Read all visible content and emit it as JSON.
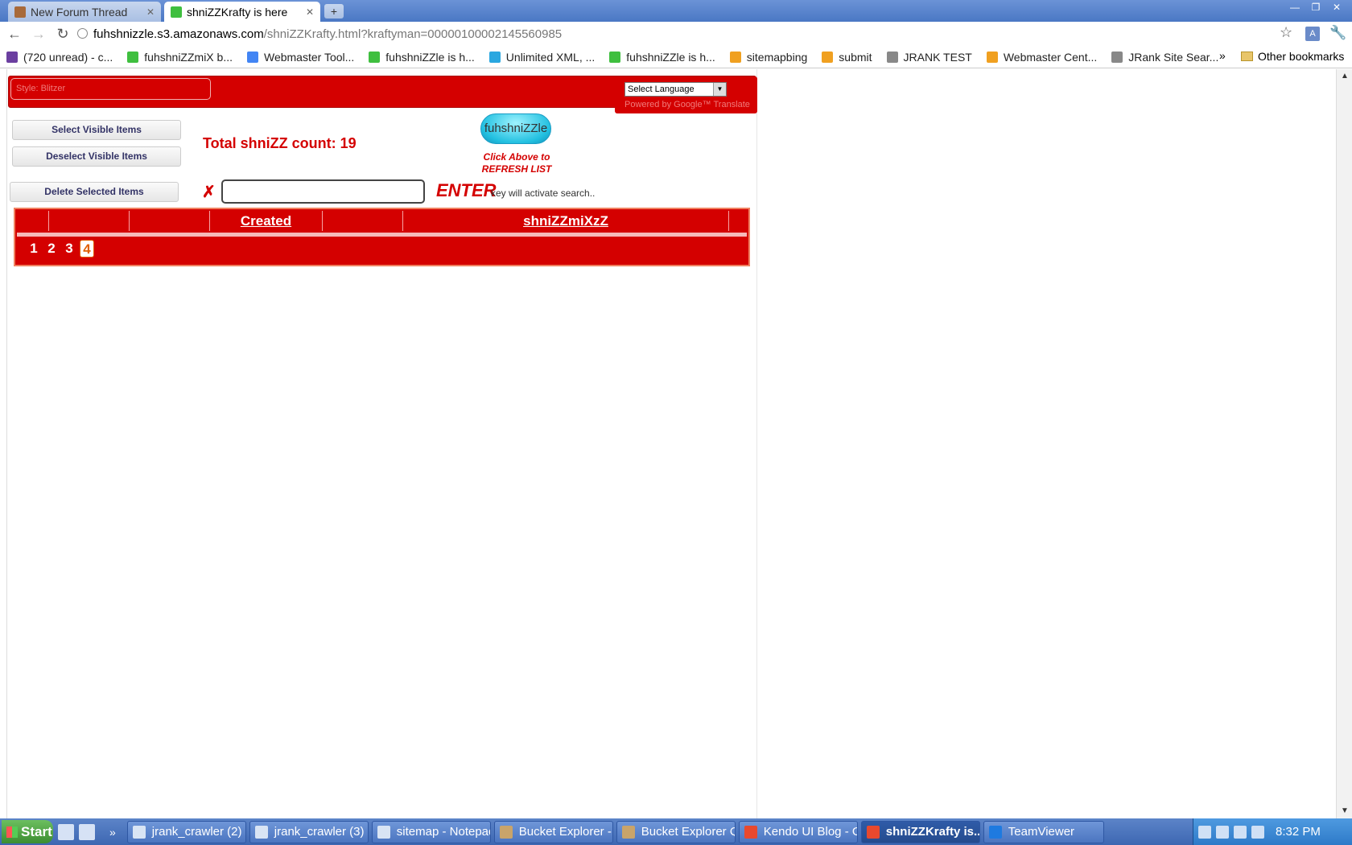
{
  "browser": {
    "tabs": [
      {
        "title": "New Forum Thread",
        "active": false
      },
      {
        "title": "shniZZKrafty is here",
        "active": true
      }
    ],
    "url_host": "fuhshnizzle.s3.amazonaws.com",
    "url_path": "/shniZZKrafty.html?kraftyman=000001000021455609​85",
    "bookmarks": [
      {
        "label": "(720 unread) - c...",
        "color": "#6b3fa0"
      },
      {
        "label": "fuhshniZZmiX b...",
        "color": "#3fbf3f"
      },
      {
        "label": "Webmaster Tool...",
        "color": "#4285f4"
      },
      {
        "label": "fuhshniZZle is h...",
        "color": "#3fbf3f"
      },
      {
        "label": "Unlimited XML, ...",
        "color": "#2aa7e0"
      },
      {
        "label": "fuhshniZZle is h...",
        "color": "#3fbf3f"
      },
      {
        "label": "sitemapbing",
        "color": "#f0a020"
      },
      {
        "label": "submit",
        "color": "#f0a020"
      },
      {
        "label": "JRANK TEST",
        "color": "#888888"
      },
      {
        "label": "Webmaster Cent...",
        "color": "#f0a020"
      },
      {
        "label": "JRank Site Sear...",
        "color": "#888888"
      }
    ],
    "bookmarks_more": "»",
    "other_bookmarks": "Other bookmarks"
  },
  "page": {
    "style_label": "Style: Blitzer",
    "language_select": "Select Language",
    "powered_by": "Powered by Google™ Translate",
    "buttons": {
      "select_visible": "Select Visible Items",
      "deselect_visible": "Deselect Visible Items",
      "delete_selected": "Delete Selected Items"
    },
    "total_count": "Total shniZZ count: 19",
    "logo_text": "fuhshniZZle",
    "refresh_text": "Click Above to REFRESH LIST",
    "search_value": "",
    "enter_label": "ENTER",
    "enter_hint": "key will activate search..",
    "columns": [
      "",
      "",
      "",
      "Created",
      "",
      "shniZZmiXzZ"
    ],
    "pages": [
      "1",
      "2",
      "3",
      "4"
    ],
    "current_page": "4"
  },
  "taskbar": {
    "start": "Start",
    "more": "»",
    "tasks": [
      {
        "label": "jrank_crawler (2) ...",
        "color": "#d8e4f4",
        "active": false
      },
      {
        "label": "jrank_crawler (3) ...",
        "color": "#d8e4f4",
        "active": false
      },
      {
        "label": "sitemap - Notepad",
        "color": "#d8e4f4",
        "active": false
      },
      {
        "label": "Bucket Explorer - ...",
        "color": "#c9a46a",
        "active": false
      },
      {
        "label": "Bucket Explorer Q...",
        "color": "#c9a46a",
        "active": false
      },
      {
        "label": "Kendo UI Blog - G...",
        "color": "#e8492e",
        "active": false
      },
      {
        "label": "shniZZKrafty is...",
        "color": "#e8492e",
        "active": true
      },
      {
        "label": "TeamViewer",
        "color": "#1e7ae0",
        "active": false
      }
    ],
    "clock": "8:32 PM"
  }
}
